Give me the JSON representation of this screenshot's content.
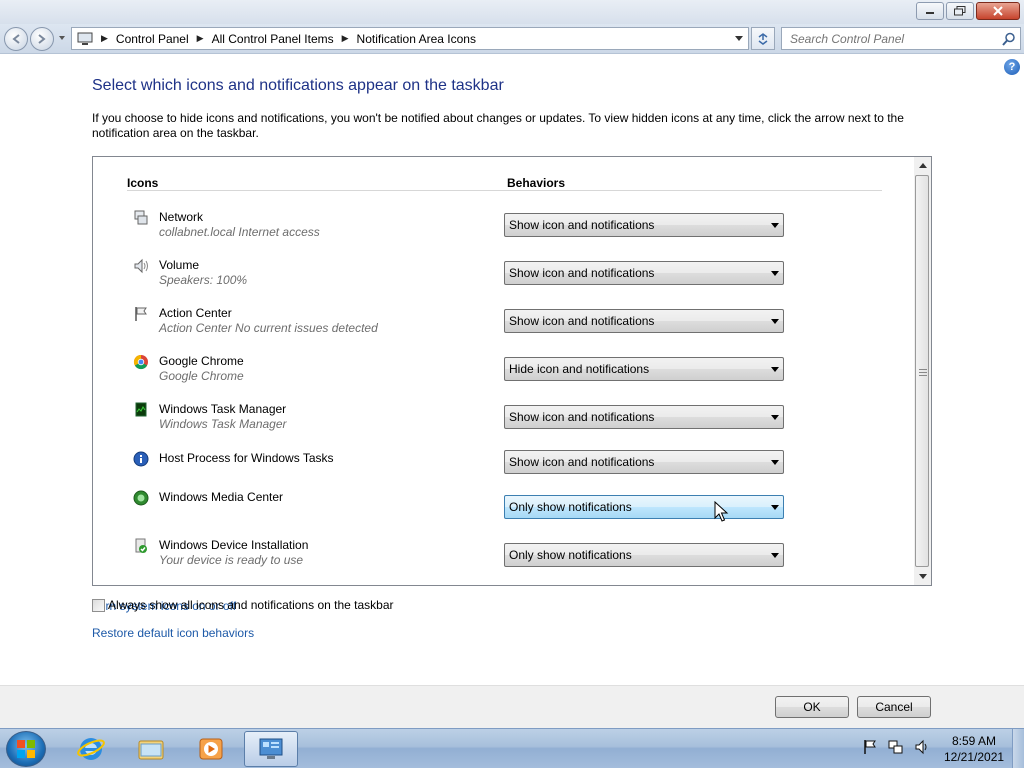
{
  "window": {
    "minimize_icon": "minimize-icon",
    "maximize_icon": "restore-icon",
    "close_icon": "close-icon"
  },
  "address": {
    "breadcrumbs": [
      "Control Panel",
      "All Control Panel Items",
      "Notification Area Icons"
    ],
    "search_placeholder": "Search Control Panel"
  },
  "page": {
    "title": "Select which icons and notifications appear on the taskbar",
    "intro": "If you choose to hide icons and notifications, you won't be notified about changes or updates. To view hidden icons at any time, click the arrow next to the notification area on the taskbar.",
    "col_icons": "Icons",
    "col_behaviors": "Behaviors",
    "rows": [
      {
        "name": "Network",
        "desc": "collabnet.local Internet access",
        "behavior": "Show icon and notifications",
        "icon": "network-icon"
      },
      {
        "name": "Volume",
        "desc": "Speakers: 100%",
        "behavior": "Show icon and notifications",
        "icon": "speaker-icon"
      },
      {
        "name": "Action Center",
        "desc": "Action Center  No current issues detected",
        "behavior": "Show icon and notifications",
        "icon": "flag-icon"
      },
      {
        "name": "Google Chrome",
        "desc": "Google Chrome",
        "behavior": "Hide icon and notifications",
        "icon": "chrome-icon"
      },
      {
        "name": "Windows Task Manager",
        "desc": "Windows Task Manager",
        "behavior": "Show icon and notifications",
        "icon": "task-manager-icon"
      },
      {
        "name": "Host Process for Windows Tasks",
        "desc": "",
        "behavior": "Show icon and notifications",
        "icon": "info-icon"
      },
      {
        "name": "Windows Media Center",
        "desc": "",
        "behavior": "Only show notifications",
        "icon": "media-center-icon"
      },
      {
        "name": "Windows Device Installation",
        "desc": "Your device is ready to use",
        "behavior": "Only show notifications",
        "icon": "device-install-icon"
      }
    ],
    "link_system_icons": "Turn system icons on or off",
    "link_restore": "Restore default icon behaviors",
    "always_show_label": "Always show all icons and notifications on the taskbar",
    "always_show_checked": false
  },
  "footer": {
    "ok_label": "OK",
    "cancel_label": "Cancel"
  },
  "taskbar": {
    "time": "8:59 AM",
    "date": "12/21/2021",
    "pinned": [
      "internet-explorer-icon",
      "windows-explorer-icon",
      "media-player-icon",
      "control-panel-icon"
    ]
  },
  "colors": {
    "title_text": "#1e3287",
    "link_text": "#1e5aa8",
    "desc_text": "#6d6d6d"
  }
}
